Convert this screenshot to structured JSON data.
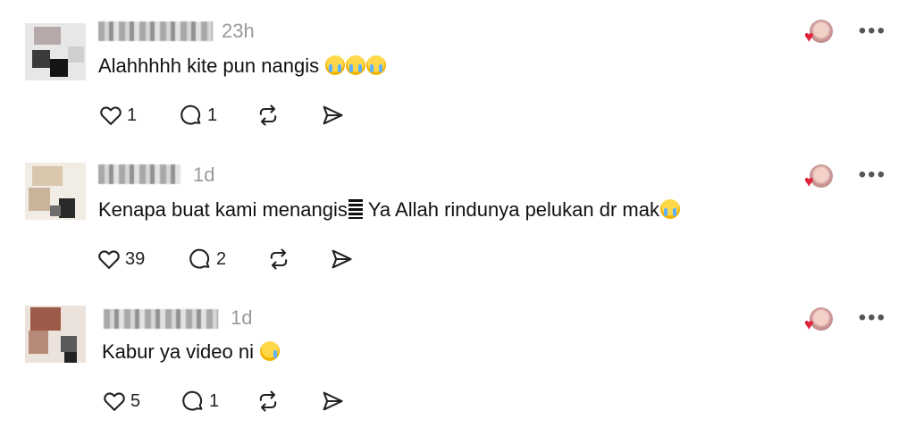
{
  "comments": [
    {
      "time": "23h",
      "text": "Alahhhhh kite pun nangis ",
      "emojis": [
        "crying-face",
        "crying-face",
        "crying-face"
      ],
      "likes": "1",
      "replies": "1"
    },
    {
      "time": "1d",
      "text_before": "Kenapa buat kami menangis",
      "text_after": "Ya Allah rindunya pelukan dr mak",
      "likes": "39",
      "replies": "2"
    },
    {
      "time": "1d",
      "text": "Kabur ya video ni ",
      "likes": "5",
      "replies": "1"
    }
  ],
  "more_label": "•••",
  "heart_glyph": "♥",
  "colors": {
    "heart": "#e0213b",
    "muted": "#9a9a9a",
    "text": "#111111"
  }
}
